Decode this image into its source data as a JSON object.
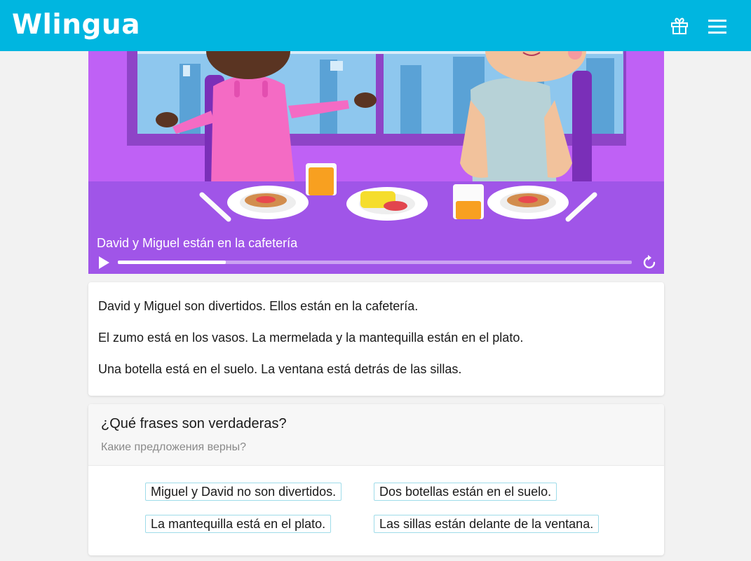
{
  "header": {
    "logo": "Wlingua",
    "gift_icon": "gift-icon",
    "menu_icon": "hamburger-menu-icon",
    "bar_color": "#00b6e0"
  },
  "video": {
    "caption": "David y Miguel están en la cafetería",
    "progress": 0.21,
    "play_icon": "play-icon",
    "replay_icon": "replay-icon"
  },
  "reading": {
    "paragraphs": [
      "David y Miguel son divertidos. Ellos están en la cafetería.",
      "El zumo está en los vasos. La mermelada y la mantequilla están en el plato.",
      "Una botella está en el suelo. La ventana está detrás de las sillas."
    ]
  },
  "quiz": {
    "question": "¿Qué frases son verdaderas?",
    "translation": "Какие предложения верны?",
    "options": [
      "Miguel y David no son divertidos.",
      "Dos botellas están en el suelo.",
      "La mantequilla está en el plato.",
      "Las sillas están delante de la ventana."
    ]
  }
}
